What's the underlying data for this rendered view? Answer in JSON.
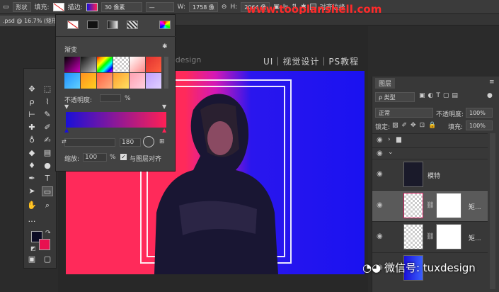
{
  "options_bar": {
    "shape_mode": "形状",
    "fill_label": "填充:",
    "stroke_label": "描边:",
    "stroke_width": "30 像素",
    "w_label": "W:",
    "w_value": "1758 像",
    "h_label": "H:",
    "h_value": "2064 像",
    "align_edges": "对齐边缘"
  },
  "watermark_url": "www.tooplanshell.com",
  "doc_tab": ".psd @ 16.7% (矩形",
  "artboard": {
    "header_text": "UI｜视觉设计｜PS教程",
    "sub_text": "tuxdesign"
  },
  "fill_popup": {
    "gradient_label": "渐变",
    "opacity_label": "不透明度:",
    "opacity_unit": "%",
    "angle_value": "180",
    "scale_label": "缩放:",
    "scale_value": "100",
    "scale_unit": "%",
    "align_with_layer": "与图层对齐"
  },
  "layers_panel": {
    "tab": "图层",
    "kind_filter": "ρ 类型",
    "blend_mode": "正常",
    "opacity_label": "不透明度:",
    "opacity_value": "100%",
    "lock_label": "锁定:",
    "fill_label": "填充:",
    "fill_value": "100%",
    "layer_model": "模特",
    "layer_rect1": "矩...",
    "layer_rect2": "矩..."
  },
  "wechat": "微信号: tuxdesign",
  "colors": {
    "foreground": "#0c0c24",
    "background": "#e81050",
    "gradient_start": "#1a10d8",
    "gradient_end": "#ff2055"
  }
}
